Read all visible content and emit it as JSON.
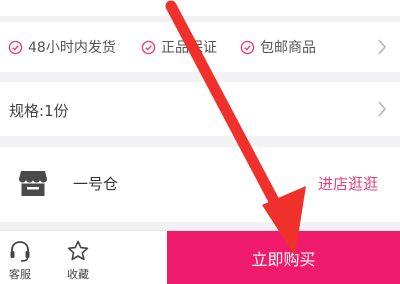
{
  "services": [
    {
      "label": "48小时内发货",
      "icon": "check-circle-icon"
    },
    {
      "label": "正品保证",
      "icon": "check-circle-icon"
    },
    {
      "label": "包邮商品",
      "icon": "check-circle-icon"
    }
  ],
  "spec": {
    "label": "规格:1份"
  },
  "store": {
    "name": "一号仓",
    "link_label": "进店逛逛",
    "icon": "store-icon"
  },
  "bottom_bar": {
    "service_label": "客服",
    "favorite_label": "收藏",
    "buy_label": "立即购买"
  },
  "colors": {
    "accent": "#e8417c",
    "buy_button": "#f01b6a",
    "annotation_arrow": "#f0302a"
  }
}
